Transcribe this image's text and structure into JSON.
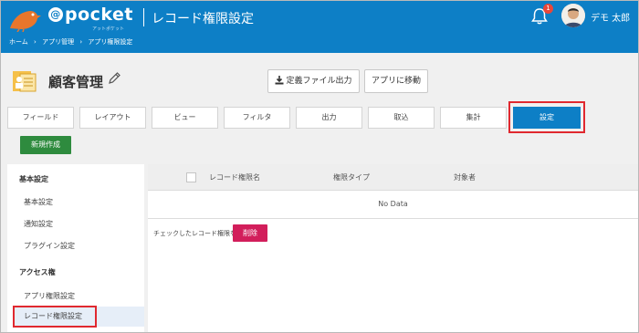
{
  "header": {
    "logo_text": "pocket",
    "logo_at": "@",
    "logo_sub": "アットポケット",
    "title": "レコード権限設定",
    "breadcrumbs": [
      "ホーム",
      "›",
      "アプリ管理",
      "›",
      "アプリ権限設定"
    ],
    "notification_count": "1",
    "user_name": "デモ 太郎"
  },
  "app": {
    "title": "顧客管理",
    "export_label": "定義ファイル出力",
    "move_label": "アプリに移動"
  },
  "tabs": [
    {
      "label": "フィールド",
      "active": false
    },
    {
      "label": "レイアウト",
      "active": false
    },
    {
      "label": "ビュー",
      "active": false
    },
    {
      "label": "フィルタ",
      "active": false
    },
    {
      "label": "出力",
      "active": false
    },
    {
      "label": "取込",
      "active": false
    },
    {
      "label": "集計",
      "active": false
    },
    {
      "label": "設定",
      "active": true
    }
  ],
  "new_button": "新規作成",
  "sidebar": {
    "section1": "基本設定",
    "items1": [
      "基本設定",
      "通知設定",
      "プラグイン設定"
    ],
    "section2": "アクセス権",
    "items2": [
      "アプリ権限設定",
      "レコード権限設定"
    ]
  },
  "table": {
    "columns": [
      "レコード権限名",
      "権限タイプ",
      "対象者"
    ],
    "empty_text": "No Data",
    "checked_label": "チェックしたレコード権限を",
    "delete_label": "削除"
  },
  "colors": {
    "header_bg": "#0d7fc6",
    "active_tab": "#0d7fc6",
    "new_button": "#2e8b3e",
    "delete_button": "#d21e5b",
    "highlight": "#e0282f"
  }
}
